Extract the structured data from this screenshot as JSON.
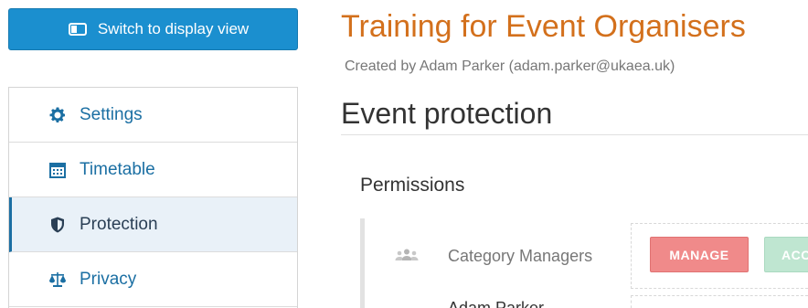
{
  "toolbar": {
    "switch_label": "Switch to display view",
    "switch_icon": "display-icon"
  },
  "sidebar": {
    "items": [
      {
        "label": "Settings",
        "icon": "gear-icon",
        "active": false
      },
      {
        "label": "Timetable",
        "icon": "calendar-icon",
        "active": false
      },
      {
        "label": "Protection",
        "icon": "shield-icon",
        "active": true
      },
      {
        "label": "Privacy",
        "icon": "scales-icon",
        "active": false
      }
    ]
  },
  "main": {
    "event_title": "Training for Event Organisers",
    "created_by": "Created by Adam Parker (adam.parker@ukaea.uk)",
    "section_title": "Event protection",
    "permissions": {
      "title": "Permissions",
      "rows": [
        {
          "principal": "Category Managers",
          "icon": "group-icon",
          "tags": [
            "MANAGE",
            "ACCESS"
          ]
        },
        {
          "principal": "Adam Parker",
          "icon": "user-icon",
          "tags": []
        }
      ]
    }
  },
  "colors": {
    "accent": "#1b8fcf",
    "title_orange": "#d3701c",
    "manage_tag": "#f08a8a",
    "access_tag": "#bfe6d1",
    "link_blue": "#1b6fa3"
  }
}
